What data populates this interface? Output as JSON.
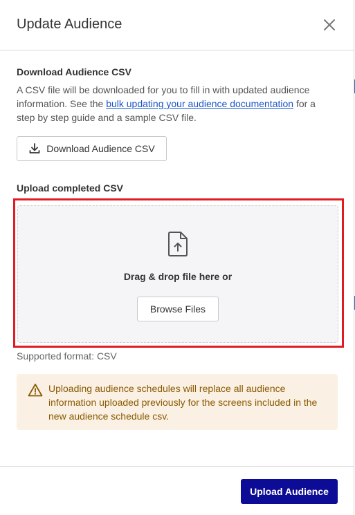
{
  "modal": {
    "title": "Update Audience",
    "close_icon": "close-icon"
  },
  "download_section": {
    "heading": "Download Audience CSV",
    "description_before": "A CSV file will be downloaded for you to fill in with updated audience information. See the ",
    "link_text": "bulk updating your audience documentation",
    "description_after": " for a step by step guide and a sample CSV file.",
    "button_label": "Download Audience CSV",
    "button_icon": "download-icon"
  },
  "upload_section": {
    "heading": "Upload completed CSV",
    "dropzone_icon": "file-upload-icon",
    "drag_text": "Drag & drop file here or",
    "browse_label": "Browse Files",
    "format_note": "Supported format: CSV"
  },
  "warning": {
    "icon": "warning-icon",
    "text": "Uploading audience schedules will replace all audience information uploaded previously for the screens included in the new audience schedule csv."
  },
  "footer": {
    "primary_label": "Upload Audience"
  },
  "colors": {
    "primary": "#0c0c96",
    "link": "#1a55c8",
    "highlight": "#e01b22",
    "warning_bg": "#faf0e4",
    "warning_text": "#8a5a00"
  }
}
